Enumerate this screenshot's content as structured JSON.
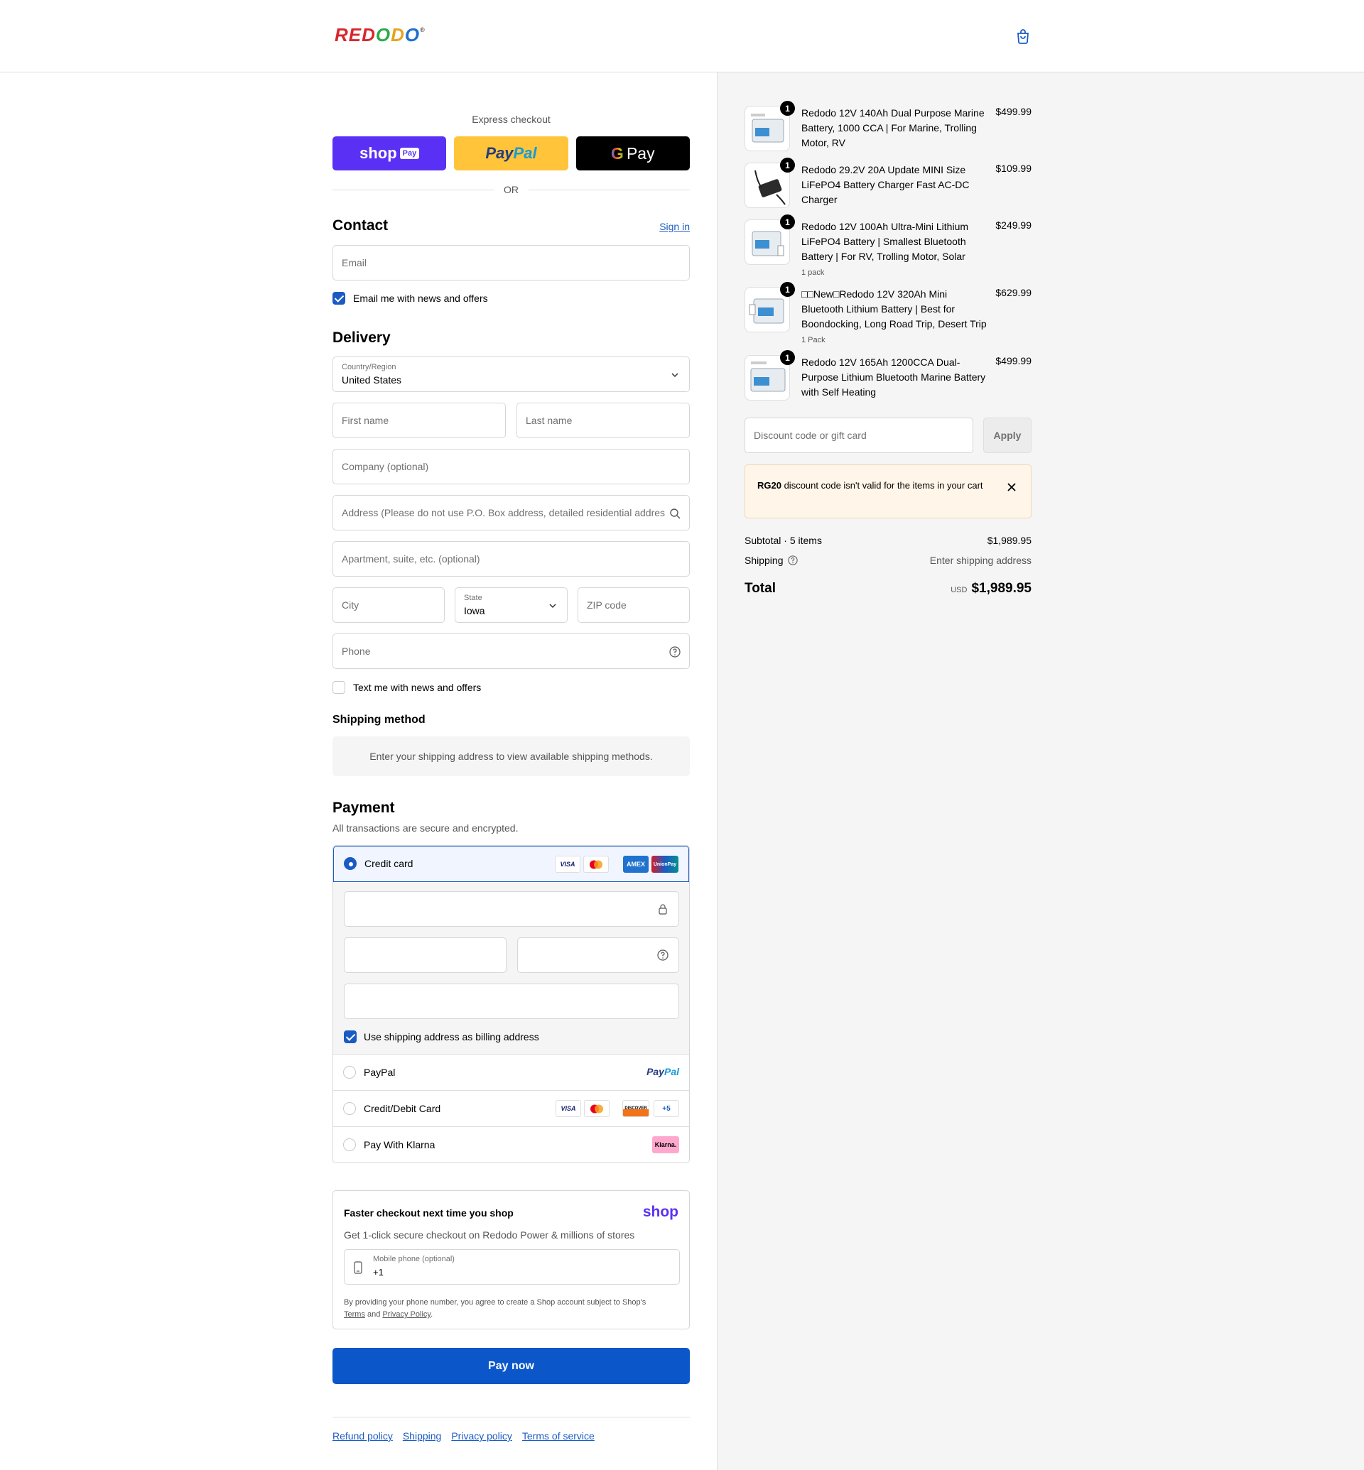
{
  "brand": {
    "logo_text": "REDODO",
    "reg": "®"
  },
  "express": {
    "title": "Express checkout",
    "shop_pay": "shop",
    "shop_pay_tag": "Pay",
    "paypal_1": "Pay",
    "paypal_2": "Pal",
    "gpay_g": "G",
    "gpay_label": "Pay",
    "or": "OR"
  },
  "contact": {
    "title": "Contact",
    "sign_in": "Sign in",
    "email_placeholder": "Email",
    "news_label": "Email me with news and offers",
    "news_checked": true
  },
  "delivery": {
    "title": "Delivery",
    "country_label": "Country/Region",
    "country_value": "United States",
    "first_name": "First name",
    "last_name": "Last name",
    "company": "Company (optional)",
    "address": "Address (Please do not use P.O. Box address, detailed residential addres...",
    "apartment": "Apartment, suite, etc. (optional)",
    "city": "City",
    "state_label": "State",
    "state_value": "Iowa",
    "zip": "ZIP code",
    "phone": "Phone",
    "text_label": "Text me with news and offers",
    "text_checked": false
  },
  "shipping_method": {
    "title": "Shipping method",
    "message": "Enter your shipping address to view available shipping methods."
  },
  "payment": {
    "title": "Payment",
    "subtitle": "All transactions are secure and encrypted.",
    "credit_card": "Credit card",
    "card_badges": [
      "VISA",
      "MC",
      "AMEX",
      "UnionPay"
    ],
    "billing_label": "Use shipping address as billing address",
    "billing_checked": true,
    "paypal": "PayPal",
    "paypal_logo_1": "Pay",
    "paypal_logo_2": "Pal",
    "debit": "Credit/Debit Card",
    "debit_badges": [
      "VISA",
      "MC",
      "DISCOVER",
      "+5"
    ],
    "klarna": "Pay With Klarna",
    "klarna_badge": "Klarna."
  },
  "shop_promo": {
    "title": "Faster checkout next time you shop",
    "logo": "shop",
    "desc": "Get 1-click secure checkout on Redodo Power & millions of stores",
    "phone_label": "Mobile phone (optional)",
    "phone_value": "+1",
    "legal_1": "By providing your phone number, you agree to create a Shop account subject to Shop's",
    "terms": "Terms",
    "and": "and",
    "privacy": "Privacy Policy",
    "period": "."
  },
  "pay_now": "Pay now",
  "footer": [
    "Refund policy",
    "Shipping",
    "Privacy policy",
    "Terms of service"
  ],
  "cart": {
    "items": [
      {
        "qty": "1",
        "name": "Redodo 12V 140Ah Dual Purpose Marine Battery, 1000 CCA | For Marine, Trolling Motor, RV",
        "variant": "",
        "price": "$499.99"
      },
      {
        "qty": "1",
        "name": "Redodo 29.2V 20A Update MINI Size LiFePO4 Battery Charger Fast AC-DC Charger",
        "variant": "",
        "price": "$109.99"
      },
      {
        "qty": "1",
        "name": "Redodo 12V 100Ah Ultra-Mini Lithium LiFePO4 Battery | Smallest Bluetooth Battery | For RV, Trolling Motor, Solar",
        "variant": "1 pack",
        "price": "$249.99"
      },
      {
        "qty": "1",
        "name": "□□New□Redodo 12V 320Ah Mini Bluetooth Lithium Battery | Best for Boondocking, Long Road Trip, Desert Trip",
        "variant": "1 Pack",
        "price": "$629.99"
      },
      {
        "qty": "1",
        "name": "Redodo 12V 165Ah 1200CCA Dual-Purpose Lithium Bluetooth Marine Battery with Self Heating",
        "variant": "",
        "price": "$499.99"
      }
    ],
    "discount_placeholder": "Discount code or gift card",
    "apply": "Apply",
    "notice_code": "RG20",
    "notice_text": " discount code isn't valid for the items in your cart",
    "subtotal_label": "Subtotal · 5 items",
    "subtotal_value": "$1,989.95",
    "shipping_label": "Shipping",
    "shipping_value": "Enter shipping address",
    "total_label": "Total",
    "currency": "USD",
    "total_value": "$1,989.95"
  }
}
